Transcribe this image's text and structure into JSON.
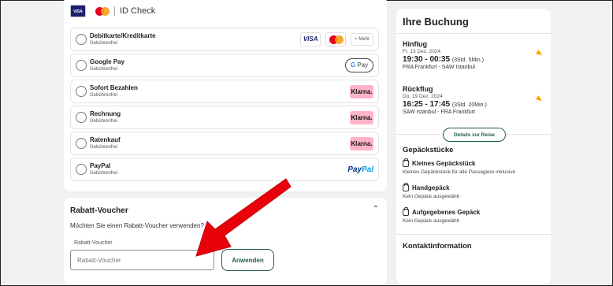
{
  "payment": {
    "header": {
      "card_brand": "VISA",
      "id_check": "ID Check"
    },
    "methods": [
      {
        "title": "Debitkarte/Kreditkarte",
        "fee": "Gebührenfrei",
        "more": "+ Mehr",
        "visa": "VISA"
      },
      {
        "title": "Google Pay",
        "fee": "Gebührenfrei",
        "badge": "Pay",
        "badge_g": "G"
      },
      {
        "title": "Sofort Bezahlen",
        "fee": "Gebührenfrei",
        "badge": "Klarna."
      },
      {
        "title": "Rechnung",
        "fee": "Gebührenfrei",
        "badge": "Klarna."
      },
      {
        "title": "Ratenkauf",
        "fee": "Gebührenfrei",
        "badge": "Klarna."
      },
      {
        "title": "PayPal",
        "fee": "Gebührenfrei",
        "badge_a": "Pay",
        "badge_b": "Pal"
      }
    ]
  },
  "voucher": {
    "title": "Rabatt-Voucher",
    "question": "Möchten Sie einen Rabatt-Voucher verwenden?",
    "label": "Rabatt-Voucher",
    "placeholder": "Rabatt-Voucher",
    "apply": "Anwenden"
  },
  "booking": {
    "title": "Ihre Buchung",
    "outbound": {
      "direction": "Hinflug",
      "date": "Fr. 13 Dez. 2024",
      "time": "19:30 - 00:35",
      "duration": "(3Std. 5Min.)",
      "route": "FRA Frankfurt - SAW Istanbul"
    },
    "return": {
      "direction": "Rückflug",
      "date": "Do. 19 Dez. 2024",
      "time": "16:25 - 17:45",
      "duration": "(3Std. 20Min.)",
      "route": "SAW Istanbul - FRA Frankfurt"
    },
    "details_button": "Details zur Reise",
    "baggage_title": "Gepäckstücke",
    "baggage": [
      {
        "title": "Kleines Gepäckstück",
        "desc": "Kleines Gepäckstück für alle Passagiere inklusive"
      },
      {
        "title": "Handgepäck",
        "desc": "Kein Gepäck ausgewählt"
      },
      {
        "title": "Aufgegebenes Gepäck",
        "desc": "Kein Gepäck ausgewählt"
      }
    ],
    "contact_title": "Kontaktinformation"
  },
  "colors": {
    "accent": "#1f5c44",
    "annotation_arrow": "#e8000b",
    "klarna": "#ffb3c7"
  }
}
